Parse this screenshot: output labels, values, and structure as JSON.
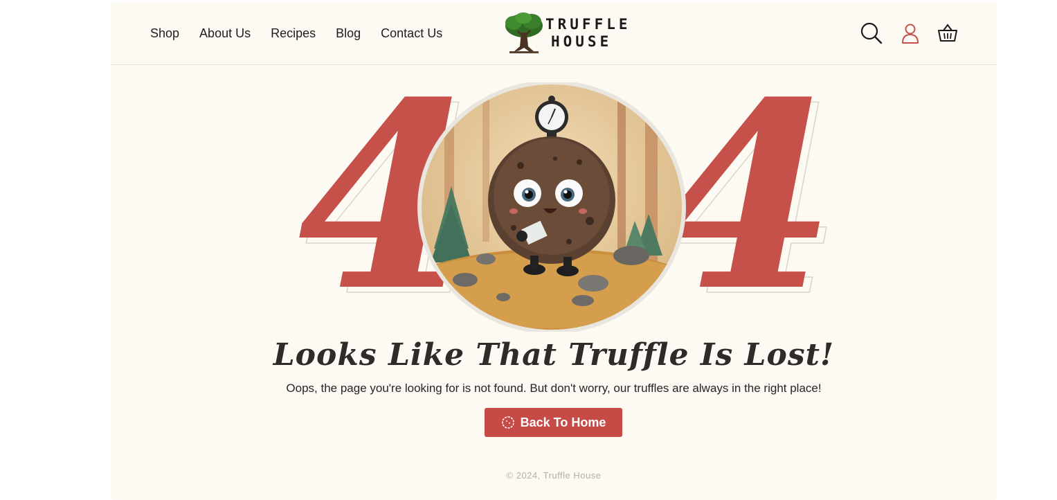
{
  "nav": {
    "items": [
      {
        "label": "Shop"
      },
      {
        "label": "About Us"
      },
      {
        "label": "Recipes"
      },
      {
        "label": "Blog"
      },
      {
        "label": "Contact Us"
      }
    ]
  },
  "logo": {
    "line1": "TRUFFLE",
    "line2": "HOUSE"
  },
  "header_icons": {
    "search": "search-icon",
    "account": "user-icon",
    "cart": "basket-icon"
  },
  "hero": {
    "digit_left": "4",
    "digit_right": "4",
    "illustration": "truffle-mascot-with-compass-in-forest"
  },
  "content": {
    "title": "Looks Like That Truffle Is Lost!",
    "subtitle": "Oops, the page you're looking for is not found. But don't worry, our truffles are always in the right place!",
    "cta_label": "Back To Home",
    "cta_icon": "truffle-icon"
  },
  "footer": {
    "copyright": "© 2024, Truffle House"
  },
  "colors": {
    "accent": "#c6504a",
    "background": "#fdfaf4",
    "text": "#1e1e1e"
  }
}
